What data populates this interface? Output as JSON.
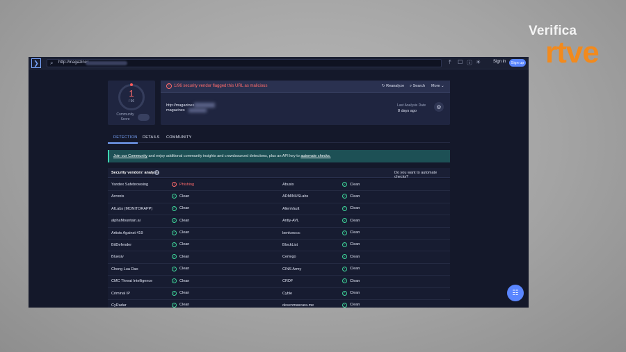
{
  "brand": {
    "top": "Verifica",
    "bottom": "rtve"
  },
  "topbar": {
    "url_text": "http://magazines",
    "signin_label": "Sign in",
    "signup_label": "Sign up"
  },
  "score": {
    "detections": "1",
    "denominator": "/ 96",
    "community_label": "Community Score"
  },
  "summary": {
    "alert_text": "1/96 security vendor flagged this URL as malicious",
    "reanalyze_label": "Reanalyze",
    "search_label": "Search",
    "more_label": "More",
    "url_line1": "http://magazines",
    "url_line2": "magazines",
    "last_analysis_label": "Last Analysis Date",
    "last_analysis_value": "8 days ago"
  },
  "tabs": [
    {
      "label": "DETECTION",
      "active": true
    },
    {
      "label": "DETAILS",
      "active": false
    },
    {
      "label": "COMMUNITY",
      "active": false
    }
  ],
  "banner": {
    "link1": "Join our Community",
    "middle": " and enjoy additional community insights and crowdsourced detections, plus an API key to ",
    "link2": "automate checks."
  },
  "vendors_header": {
    "title": "Security vendors' analysis",
    "right": "Do you want to automate checks?"
  },
  "rows": [
    {
      "v1": "Yandex Safebrowsing",
      "r1": "Phishing",
      "s1": "mal",
      "v2": "Abusix",
      "r2": "Clean",
      "s2": "clean"
    },
    {
      "v1": "Acronis",
      "r1": "Clean",
      "s1": "clean",
      "v2": "ADMINUSLabs",
      "r2": "Clean",
      "s2": "clean"
    },
    {
      "v1": "AILabs (MONITORAPP)",
      "r1": "Clean",
      "s1": "clean",
      "v2": "AlienVault",
      "r2": "Clean",
      "s2": "clean"
    },
    {
      "v1": "alphaMountain.ai",
      "r1": "Clean",
      "s1": "clean",
      "v2": "Antiy-AVL",
      "r2": "Clean",
      "s2": "clean"
    },
    {
      "v1": "Artists Against 419",
      "r1": "Clean",
      "s1": "clean",
      "v2": "benkow.cc",
      "r2": "Clean",
      "s2": "clean"
    },
    {
      "v1": "BitDefender",
      "r1": "Clean",
      "s1": "clean",
      "v2": "BlockList",
      "r2": "Clean",
      "s2": "clean"
    },
    {
      "v1": "Bluesiv",
      "r1": "Clean",
      "s1": "clean",
      "v2": "Certego",
      "r2": "Clean",
      "s2": "clean"
    },
    {
      "v1": "Chong Lua Dao",
      "r1": "Clean",
      "s1": "clean",
      "v2": "CINS Army",
      "r2": "Clean",
      "s2": "clean"
    },
    {
      "v1": "CMC Threat Intelligence",
      "r1": "Clean",
      "s1": "clean",
      "v2": "CRDF",
      "r2": "Clean",
      "s2": "clean"
    },
    {
      "v1": "Criminal IP",
      "r1": "Clean",
      "s1": "clean",
      "v2": "Cyble",
      "r2": "Clean",
      "s2": "clean"
    },
    {
      "v1": "CyRadar",
      "r1": "Clean",
      "s1": "clean",
      "v2": "desenmascara.me",
      "r2": "Clean",
      "s2": "clean"
    }
  ]
}
